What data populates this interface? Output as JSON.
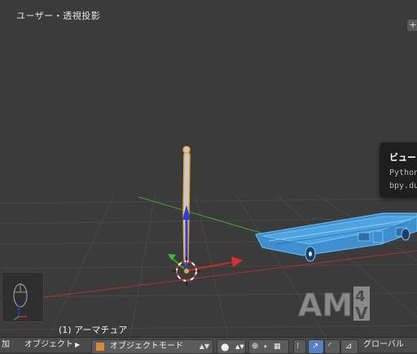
{
  "viewport": {
    "title": "ユーザー・透視投影",
    "active_object": "(1) アーマチュア"
  },
  "tooltip": {
    "title": "ビュー",
    "line1": "Python",
    "line2": "bpy.du"
  },
  "watermark": {
    "text": "AM",
    "number": "4",
    "letter": "V"
  },
  "statusbar": {
    "menu_partial": "加",
    "object_menu": "オブジェクト",
    "mode_select": "オブジェクトモード",
    "orientation": "グローバル"
  },
  "colors": {
    "viewport_bg": "#3b3b3b",
    "grid": "#4a4a4a",
    "x_axis": "#b0302c",
    "y_axis": "#4aa12f",
    "bone_fill": "#c9c9c9",
    "bone_outline": "#e8a33d",
    "selected_mesh": "#4ea3e0",
    "accent": "#5680c2"
  }
}
